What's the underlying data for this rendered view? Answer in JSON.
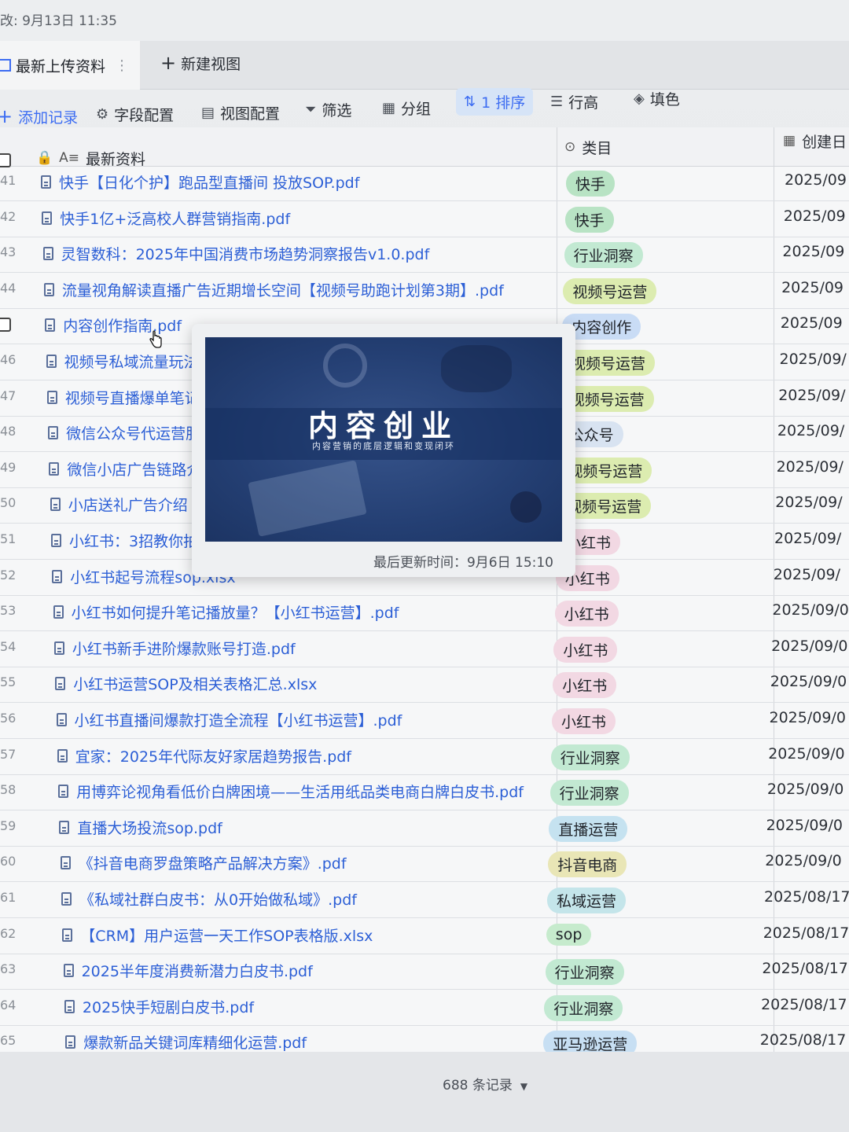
{
  "header": {
    "updated": "改: 9月13日 11:35"
  },
  "views": {
    "active": "最新上传资料",
    "more": "⋮",
    "new_view": "新建视图"
  },
  "toolbar": {
    "add_record": "添加记录",
    "field_config": "字段配置",
    "view_config": "视图配置",
    "filter": "筛选",
    "group": "分组",
    "sort": "1 排序",
    "row_height": "行高",
    "fill": "填色"
  },
  "columns": {
    "name": "最新资料",
    "category": "类目",
    "created": "创建日"
  },
  "rows": [
    {
      "num": "41",
      "file": "快手【日化个护】跑品型直播间 投放SOP.pdf",
      "tag": "快手",
      "date": "2025/09"
    },
    {
      "num": "42",
      "file": "快手1亿+泛高校人群营销指南.pdf",
      "tag": "快手",
      "date": "2025/09"
    },
    {
      "num": "43",
      "file": "灵智数科：2025年中国消费市场趋势洞察报告v1.0.pdf",
      "tag": "行业洞察",
      "date": "2025/09"
    },
    {
      "num": "44",
      "file": "流量视角解读直播广告近期增长空间【视频号助跑计划第3期】.pdf",
      "tag": "视频号运营",
      "date": "2025/09"
    },
    {
      "num": "",
      "file": "内容创作指南.pdf",
      "tag": "内容创作",
      "date": "2025/09"
    },
    {
      "num": "46",
      "file": "视频号私域流量玩法",
      "tag": "视频号运营",
      "date": "2025/09/"
    },
    {
      "num": "47",
      "file": "视频号直播爆单笔记",
      "tag": "视频号运营",
      "date": "2025/09/"
    },
    {
      "num": "48",
      "file": "微信公众号代运营服",
      "tag": "公众号",
      "date": "2025/09/"
    },
    {
      "num": "49",
      "file": "微信小店广告链路介",
      "tag": "视频号运营",
      "date": "2025/09/"
    },
    {
      "num": "50",
      "file": "小店送礼广告介绍",
      "tag": "视频号运营",
      "date": "2025/09/"
    },
    {
      "num": "51",
      "file": "小红书：3招教你拍",
      "tag": "小红书",
      "date": "2025/09/"
    },
    {
      "num": "52",
      "file": "小红书起号流程sop.xlsx",
      "tag": "小红书",
      "date": "2025/09/"
    },
    {
      "num": "53",
      "file": "小红书如何提升笔记播放量？【小红书运营】.pdf",
      "tag": "小红书",
      "date": "2025/09/0"
    },
    {
      "num": "54",
      "file": "小红书新手进阶爆款账号打造.pdf",
      "tag": "小红书",
      "date": "2025/09/0"
    },
    {
      "num": "55",
      "file": "小红书运营SOP及相关表格汇总.xlsx",
      "tag": "小红书",
      "date": "2025/09/0"
    },
    {
      "num": "56",
      "file": "小红书直播间爆款打造全流程【小红书运营】.pdf",
      "tag": "小红书",
      "date": "2025/09/0"
    },
    {
      "num": "57",
      "file": "宜家：2025年代际友好家居趋势报告.pdf",
      "tag": "行业洞察",
      "date": "2025/09/0"
    },
    {
      "num": "58",
      "file": "用博弈论视角看低价白牌困境——生活用纸品类电商白牌白皮书.pdf",
      "tag": "行业洞察",
      "date": "2025/09/0"
    },
    {
      "num": "59",
      "file": "直播大场投流sop.pdf",
      "tag": "直播运营",
      "date": "2025/09/0"
    },
    {
      "num": "60",
      "file": "《抖音电商罗盘策略产品解决方案》.pdf",
      "tag": "抖音电商",
      "date": "2025/09/0"
    },
    {
      "num": "61",
      "file": "《私域社群白皮书：从0开始做私域》.pdf",
      "tag": "私域运营",
      "date": "2025/08/17"
    },
    {
      "num": "62",
      "file": "【CRM】用户运营一天工作SOP表格版.xlsx",
      "tag": "sop",
      "date": "2025/08/17"
    },
    {
      "num": "63",
      "file": "2025半年度消费新潜力白皮书.pdf",
      "tag": "行业洞察",
      "date": "2025/08/17"
    },
    {
      "num": "64",
      "file": "2025快手短剧白皮书.pdf",
      "tag": "行业洞察",
      "date": "2025/08/17"
    },
    {
      "num": "65",
      "file": "爆款新品关键词库精细化运营.pdf",
      "tag": "亚马逊运营",
      "date": "2025/08/17"
    }
  ],
  "tag_colors": {
    "快手": "#b8e3c4",
    "行业洞察": "#c2e9d2",
    "视频号运营": "#dcecb0",
    "内容创作": "#c9dcf5",
    "公众号": "#d8e3f1",
    "小红书": "#f2d8e3",
    "直播运营": "#c5e2f0",
    "抖音电商": "#e9e6b6",
    "私域运营": "#c4e5ea",
    "sop": "#c6ebcd",
    "亚马逊运营": "#c7dff3"
  },
  "preview": {
    "title": "内容创业",
    "subtitle": "内容营销的底层逻辑和变现闭环",
    "last_updated": "最后更新时间：9月6日 15:10"
  },
  "footer": {
    "count": "688 条记录"
  }
}
